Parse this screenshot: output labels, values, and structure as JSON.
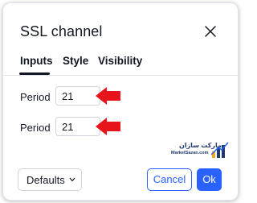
{
  "dialog": {
    "title": "SSL channel",
    "close_icon": "close-icon"
  },
  "tabs": [
    {
      "label": "Inputs",
      "active": true
    },
    {
      "label": "Style",
      "active": false
    },
    {
      "label": "Visibility",
      "active": false
    }
  ],
  "inputs": [
    {
      "label": "Period",
      "value": "21"
    },
    {
      "label": "Period",
      "value": "21"
    }
  ],
  "annotation": {
    "arrow_color": "#e8141c",
    "arrow_icon": "red-arrow-icon"
  },
  "watermark": {
    "text_fa": "مارکت سازان",
    "text_en": "MarketSazan.com",
    "icon": "bar-chart-logo-icon"
  },
  "footer": {
    "defaults_label": "Defaults",
    "cancel_label": "Cancel",
    "ok_label": "Ok"
  },
  "colors": {
    "accent": "#2962ff",
    "text": "#131722",
    "border": "#d1d4dc"
  }
}
